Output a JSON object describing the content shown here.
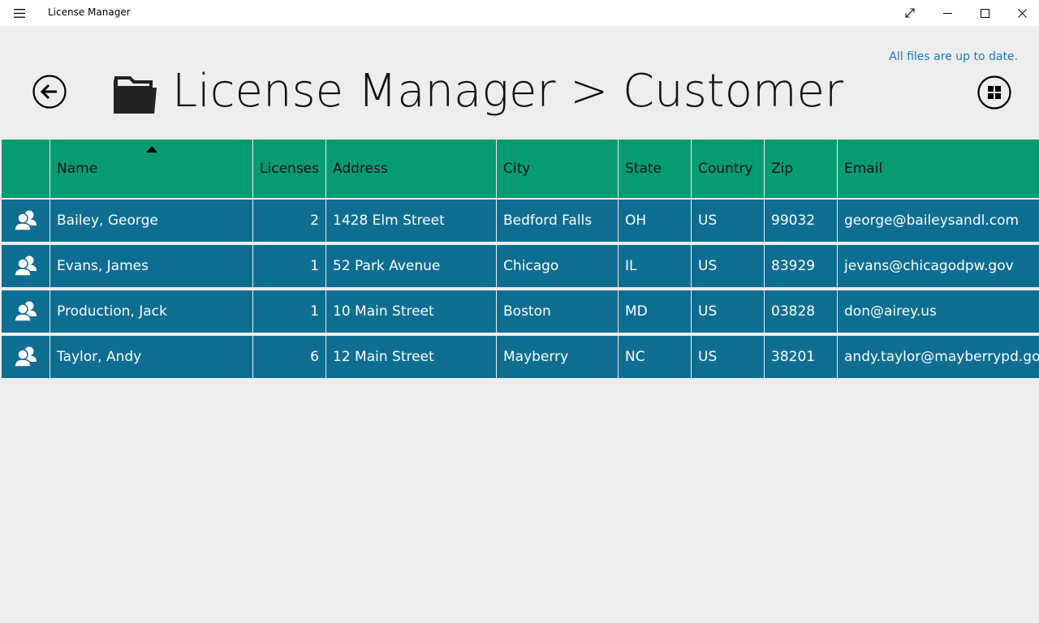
{
  "window": {
    "title": "License Manager"
  },
  "status_text": "All files are up to date.",
  "page_title": "License Manager > Customer",
  "table": {
    "headers": [
      "",
      "Name",
      "Licenses",
      "Address",
      "City",
      "State",
      "Country",
      "Zip",
      "Email"
    ],
    "sorted_column": "Name",
    "sort_direction": "ascending",
    "rows": [
      {
        "name": "Bailey, George",
        "licenses": "2",
        "address": "1428 Elm Street",
        "city": "Bedford Falls",
        "state": "OH",
        "country": "US",
        "zip": "99032",
        "email": "george@baileysandl.com"
      },
      {
        "name": "Evans, James",
        "licenses": "1",
        "address": "52 Park Avenue",
        "city": "Chicago",
        "state": "IL",
        "country": "US",
        "zip": "83929",
        "email": "jevans@chicagodpw.gov"
      },
      {
        "name": "Production, Jack",
        "licenses": "1",
        "address": "10 Main Street",
        "city": "Boston",
        "state": "MD",
        "country": "US",
        "zip": "03828",
        "email": "don@airey.us"
      },
      {
        "name": "Taylor, Andy",
        "licenses": "6",
        "address": "12 Main Street",
        "city": "Mayberry",
        "state": "NC",
        "country": "US",
        "zip": "38201",
        "email": "andy.taylor@mayberrypd.gov"
      }
    ]
  },
  "colors": {
    "header_bg": "#079b72",
    "row_bg": "#0e6e92",
    "page_bg": "#ededed",
    "status_text": "#1a7bb5"
  },
  "icons": {
    "hamburger": "hamburger-menu-icon",
    "fullscreen": "expand-icon",
    "minimize": "minimize-icon",
    "maximize": "maximize-icon",
    "close": "close-icon",
    "back": "back-arrow-icon",
    "folder": "folder-icon",
    "grid": "grid-icon",
    "customer": "people-icon"
  }
}
